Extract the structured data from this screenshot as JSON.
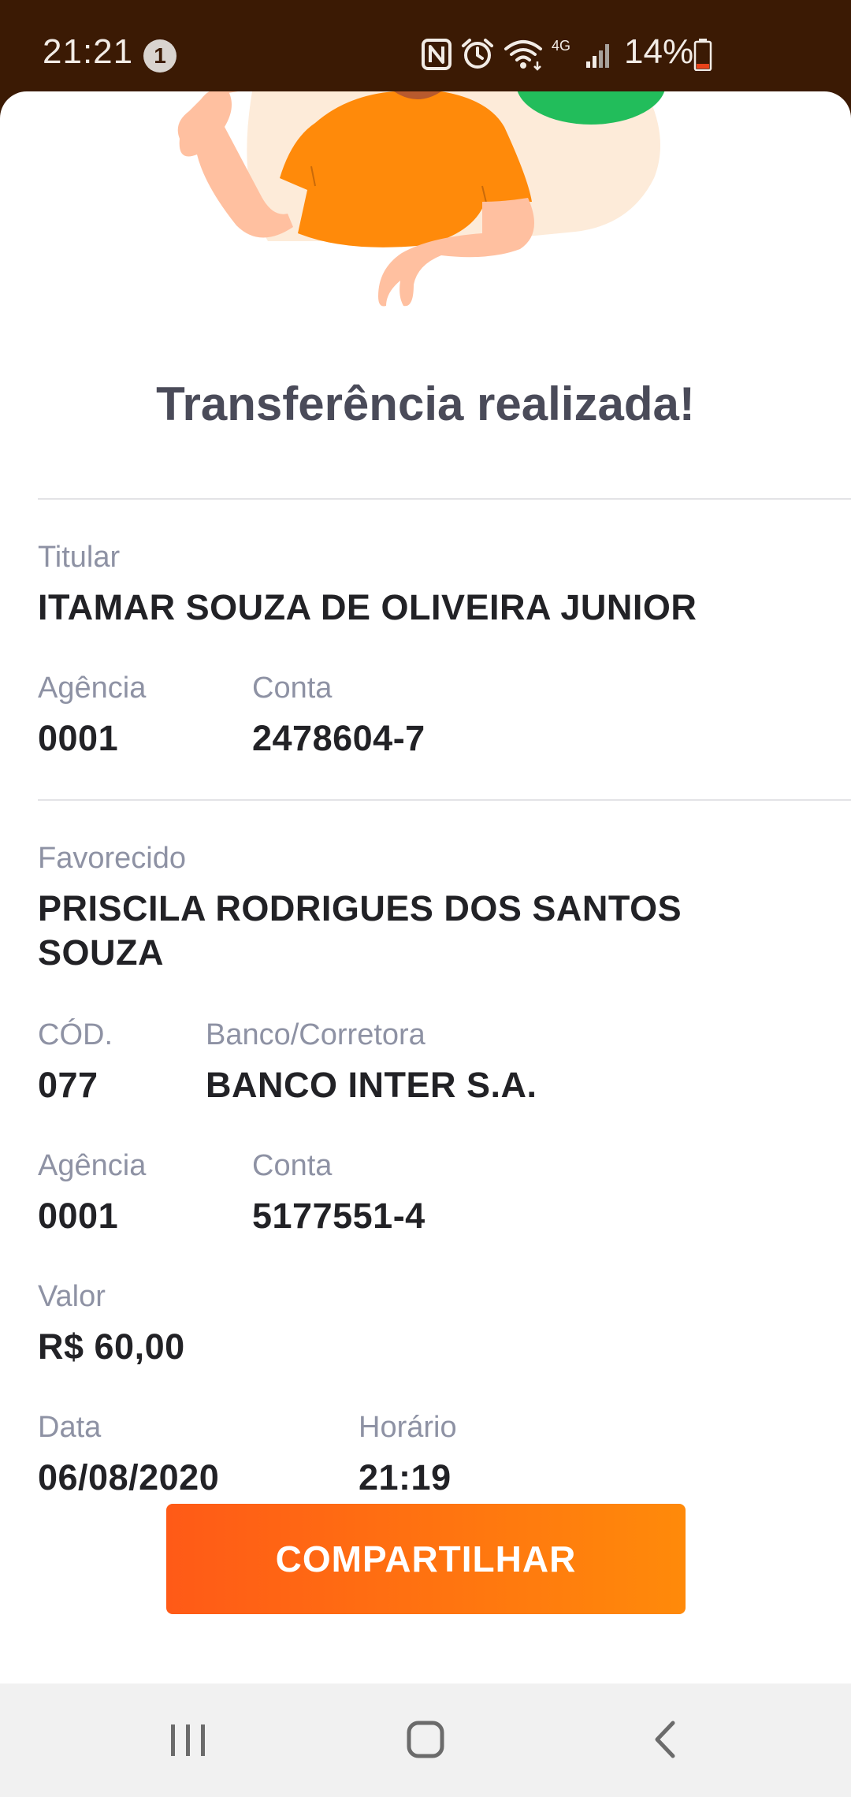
{
  "status_bar": {
    "time": "21:21",
    "notification_count": "1",
    "network_type": "4G",
    "battery_percent": "14%"
  },
  "receipt": {
    "title": "Transferência realizada!",
    "holder": {
      "label": "Titular",
      "name": "ITAMAR SOUZA DE OLIVEIRA JUNIOR",
      "agency_label": "Agência",
      "agency": "0001",
      "account_label": "Conta",
      "account": "2478604-7"
    },
    "payee": {
      "label": "Favorecido",
      "name_line1": "PRISCILA RODRIGUES DOS SANTOS",
      "name_line2": "SOUZA",
      "code_label": "CÓD.",
      "code": "077",
      "bank_label": "Banco/Corretora",
      "bank": "BANCO INTER S.A.",
      "agency_label": "Agência",
      "agency": "0001",
      "account_label": "Conta",
      "account": "5177551-4"
    },
    "amount_label": "Valor",
    "amount": "R$ 60,00",
    "date_label": "Data",
    "date": "06/08/2020",
    "time_label": "Horário",
    "time": "21:19",
    "share_label": "COMPARTILHAR"
  },
  "colors": {
    "accent_start": "#ff5a17",
    "accent_end": "#ff8a0a",
    "status_bar_bg": "#3b1a04",
    "title_color": "#4a4b59",
    "label_color": "#8e92a4"
  },
  "icons": {
    "nfc": "nfc-icon",
    "alarm": "alarm-icon",
    "wifi": "wifi-icon",
    "signal": "signal-icon",
    "battery": "battery-icon",
    "recents": "recents-icon",
    "home": "home-icon",
    "back": "back-icon"
  }
}
